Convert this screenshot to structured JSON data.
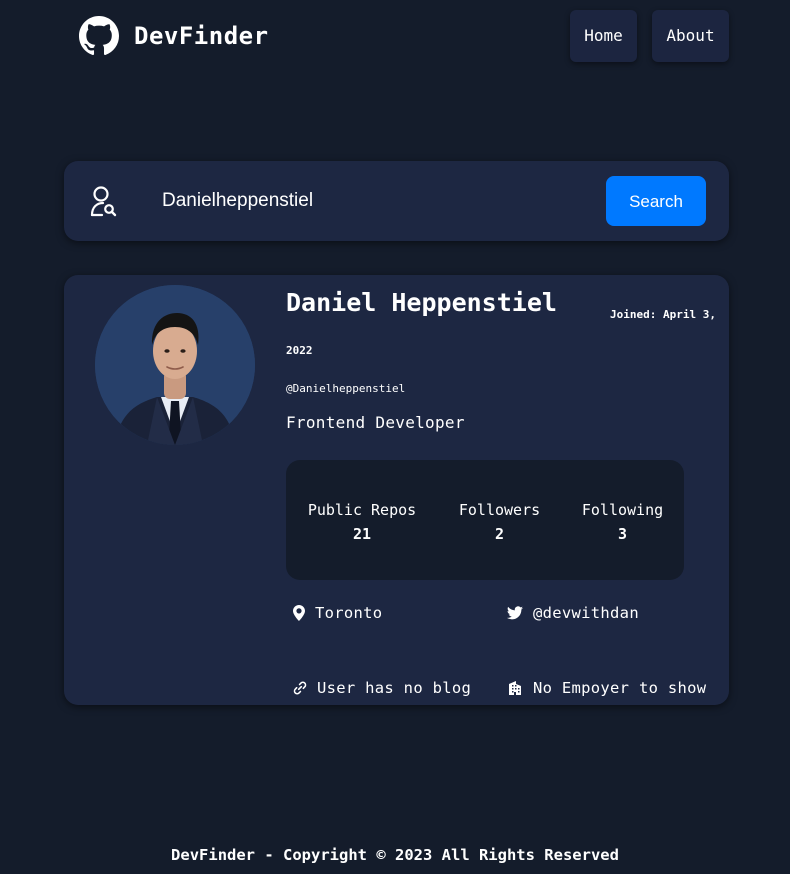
{
  "header": {
    "brand": "DevFinder",
    "logo_icon": "github-icon",
    "nav": {
      "home": "Home",
      "about": "About"
    }
  },
  "search": {
    "icon": "user-search-icon",
    "value": "Danielheppenstiel",
    "button": "Search"
  },
  "profile": {
    "name": "Daniel Heppenstiel",
    "joined": "Joined: April 3, 2022",
    "login": "@Danielheppenstiel",
    "bio": "Frontend Developer",
    "stats": [
      {
        "label": "Public Repos",
        "value": "21"
      },
      {
        "label": "Followers",
        "value": "2"
      },
      {
        "label": "Following",
        "value": "3"
      }
    ],
    "links": {
      "location": "Toronto",
      "twitter": "@devwithdan",
      "blog": "User has no blog",
      "company": "No Empoyer to show"
    }
  },
  "footer": {
    "text": "DevFinder - Copyright © 2023 All Rights Reserved"
  },
  "colors": {
    "background": "#141c2b",
    "card": "#1d2742",
    "accent": "#0079ff"
  }
}
